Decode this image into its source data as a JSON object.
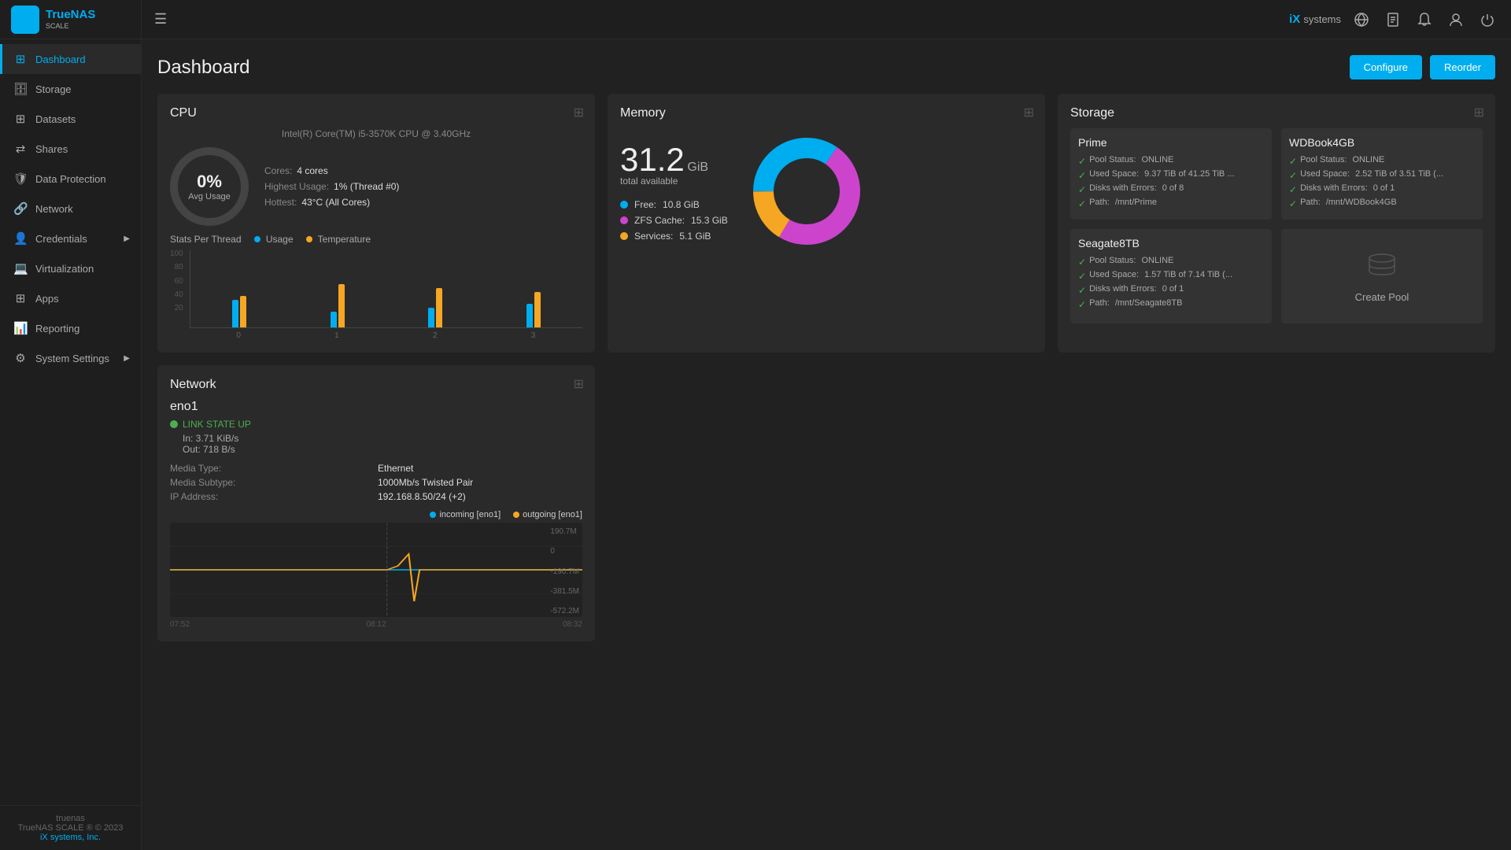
{
  "app": {
    "name": "TrueNAS",
    "subtitle": "SCALE",
    "footer_hostname": "truenas",
    "footer_version": "TrueNAS SCALE ® © 2023",
    "footer_link": "iX systems, Inc."
  },
  "topbar": {
    "logo_text": "iX systems",
    "configure_label": "Configure",
    "reorder_label": "Reorder"
  },
  "sidebar": {
    "items": [
      {
        "id": "dashboard",
        "label": "Dashboard",
        "icon": "⊞",
        "active": true,
        "has_arrow": false
      },
      {
        "id": "storage",
        "label": "Storage",
        "icon": "🗄",
        "active": false,
        "has_arrow": false
      },
      {
        "id": "datasets",
        "label": "Datasets",
        "icon": "⊞",
        "active": false,
        "has_arrow": false
      },
      {
        "id": "shares",
        "label": "Shares",
        "icon": "⇄",
        "active": false,
        "has_arrow": false
      },
      {
        "id": "data-protection",
        "label": "Data Protection",
        "icon": "🛡",
        "active": false,
        "has_arrow": false
      },
      {
        "id": "network",
        "label": "Network",
        "icon": "🔗",
        "active": false,
        "has_arrow": false
      },
      {
        "id": "credentials",
        "label": "Credentials",
        "icon": "👤",
        "active": false,
        "has_arrow": true
      },
      {
        "id": "virtualization",
        "label": "Virtualization",
        "icon": "💻",
        "active": false,
        "has_arrow": false
      },
      {
        "id": "apps",
        "label": "Apps",
        "icon": "⊞",
        "active": false,
        "has_arrow": false
      },
      {
        "id": "reporting",
        "label": "Reporting",
        "icon": "📊",
        "active": false,
        "has_arrow": false
      },
      {
        "id": "system-settings",
        "label": "System Settings",
        "icon": "⚙",
        "active": false,
        "has_arrow": true
      }
    ]
  },
  "page": {
    "title": "Dashboard"
  },
  "cpu": {
    "title": "CPU",
    "subtitle": "Intel(R) Core(TM) i5-3570K CPU @ 3.40GHz",
    "gauge_value": "0%",
    "gauge_label": "Avg Usage",
    "stats": [
      {
        "key": "Cores:",
        "value": "4 cores"
      },
      {
        "key": "Highest Usage:",
        "value": "1%  (Thread #0)"
      },
      {
        "key": "Hottest:",
        "value": "43°C  (All Cores)"
      }
    ],
    "legend": [
      {
        "label": "Usage",
        "color": "#00adef"
      },
      {
        "label": "Temperature",
        "color": "#f5a623"
      }
    ],
    "yaxis": [
      "100",
      "80",
      "60",
      "40",
      "20"
    ],
    "xaxis": [
      "0",
      "1",
      "2",
      "3"
    ],
    "bars": [
      {
        "thread": "0",
        "usage": 35,
        "temp": 40
      },
      {
        "thread": "1",
        "usage": 20,
        "temp": 55
      },
      {
        "thread": "2",
        "usage": 25,
        "temp": 50
      },
      {
        "thread": "3",
        "usage": 30,
        "temp": 45
      }
    ]
  },
  "memory": {
    "title": "Memory",
    "total_value": "31.2",
    "total_unit": "GiB",
    "total_label": "total available",
    "legend": [
      {
        "label": "Free:",
        "value": "10.8 GiB",
        "color": "#00adef"
      },
      {
        "label": "ZFS Cache:",
        "value": "15.3 GiB",
        "color": "#cc44cc"
      },
      {
        "label": "Services:",
        "value": "5.1 GiB",
        "color": "#f5a623"
      }
    ],
    "donut": {
      "segments": [
        {
          "label": "Free",
          "value": 10.8,
          "color": "#00adef"
        },
        {
          "label": "ZFS Cache",
          "value": 15.3,
          "color": "#cc44cc"
        },
        {
          "label": "Services",
          "value": 5.1,
          "color": "#f5a623"
        }
      ],
      "total": 31.2
    }
  },
  "storage": {
    "title": "Storage",
    "pools": [
      {
        "name": "Prime",
        "stats": [
          {
            "label": "Pool Status:",
            "value": "ONLINE"
          },
          {
            "label": "Used Space:",
            "value": "9.37 TiB of 41.25 TiB ..."
          },
          {
            "label": "Disks with Errors:",
            "value": "0 of 8"
          },
          {
            "label": "Path:",
            "value": "/mnt/Prime"
          }
        ]
      },
      {
        "name": "WDBook4GB",
        "stats": [
          {
            "label": "Pool Status:",
            "value": "ONLINE"
          },
          {
            "label": "Used Space:",
            "value": "2.52 TiB of 3.51 TiB (..."
          },
          {
            "label": "Disks with Errors:",
            "value": "0 of 1"
          },
          {
            "label": "Path:",
            "value": "/mnt/WDBook4GB"
          }
        ]
      },
      {
        "name": "Seagate8TB",
        "stats": [
          {
            "label": "Pool Status:",
            "value": "ONLINE"
          },
          {
            "label": "Used Space:",
            "value": "1.57 TiB of 7.14 TiB (..."
          },
          {
            "label": "Disks with Errors:",
            "value": "0 of 1"
          },
          {
            "label": "Path:",
            "value": "/mnt/Seagate8TB"
          }
        ]
      }
    ],
    "create_pool_label": "Create Pool"
  },
  "network": {
    "title": "Network",
    "interface": {
      "name": "eno1",
      "link_state": "LINK STATE UP",
      "in": "In:  3.71 KiB/s",
      "out": "Out:  718 B/s",
      "media_type": "Ethernet",
      "media_subtype": "1000Mb/s Twisted Pair",
      "ip_address": "192.168.8.50/24 (+2)"
    },
    "chart_legend": [
      {
        "label": "incoming [eno1]",
        "color": "#00adef"
      },
      {
        "label": "outgoing [eno1]",
        "color": "#f5a623"
      }
    ],
    "yaxis_labels": [
      "190.7M",
      "0",
      "-190.7M",
      "-381.5M",
      "-572.2M"
    ],
    "xaxis_labels": [
      "07:52",
      "08:12",
      "08:32"
    ]
  }
}
